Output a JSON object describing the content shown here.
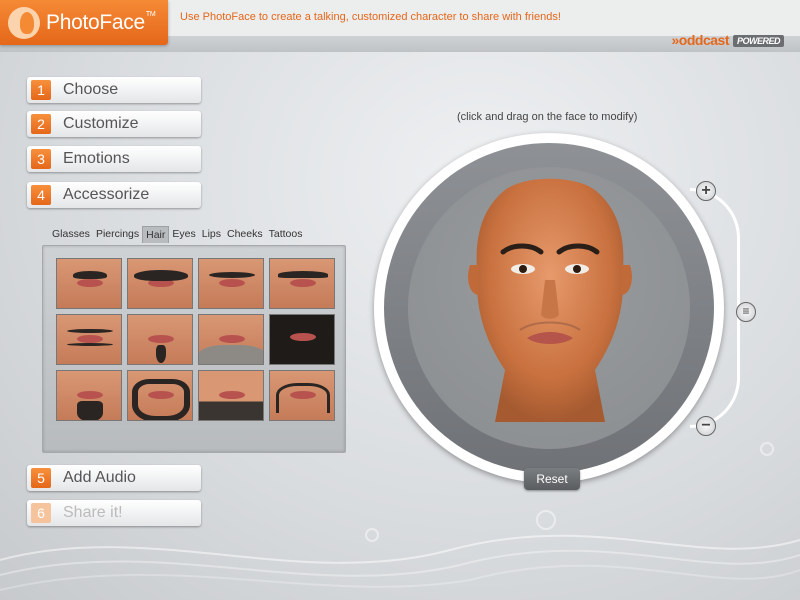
{
  "app": {
    "name": "PhotoFace",
    "tm": "TM",
    "tagline": "Use PhotoFace to create a talking, customized character to share with friends!",
    "brand": "»oddcast",
    "brand_badge": "POWERED"
  },
  "steps": [
    {
      "num": "1",
      "label": "Choose"
    },
    {
      "num": "2",
      "label": "Customize"
    },
    {
      "num": "3",
      "label": "Emotions"
    },
    {
      "num": "4",
      "label": "Accessorize"
    },
    {
      "num": "5",
      "label": "Add Audio"
    },
    {
      "num": "6",
      "label": "Share it!"
    }
  ],
  "tabs": [
    "Glasses",
    "Piercings",
    "Hair",
    "Eyes",
    "Lips",
    "Cheeks",
    "Tattoos"
  ],
  "active_tab": "Hair",
  "thumbnails": [
    "mustache-1",
    "mustache-2",
    "mustache-3",
    "mustache-4",
    "mustache-5",
    "goatee-1",
    "beard-1",
    "beard-2",
    "beard-3",
    "beard-4",
    "goatee-2",
    "handlebar"
  ],
  "editor": {
    "hint": "(click and drag on the face to modify)",
    "reset_label": "Reset",
    "zoom_in": "+",
    "zoom_mid": "≡",
    "zoom_out": "−"
  },
  "colors": {
    "accent": "#e5671a",
    "brand_gray": "#6b6e71"
  }
}
